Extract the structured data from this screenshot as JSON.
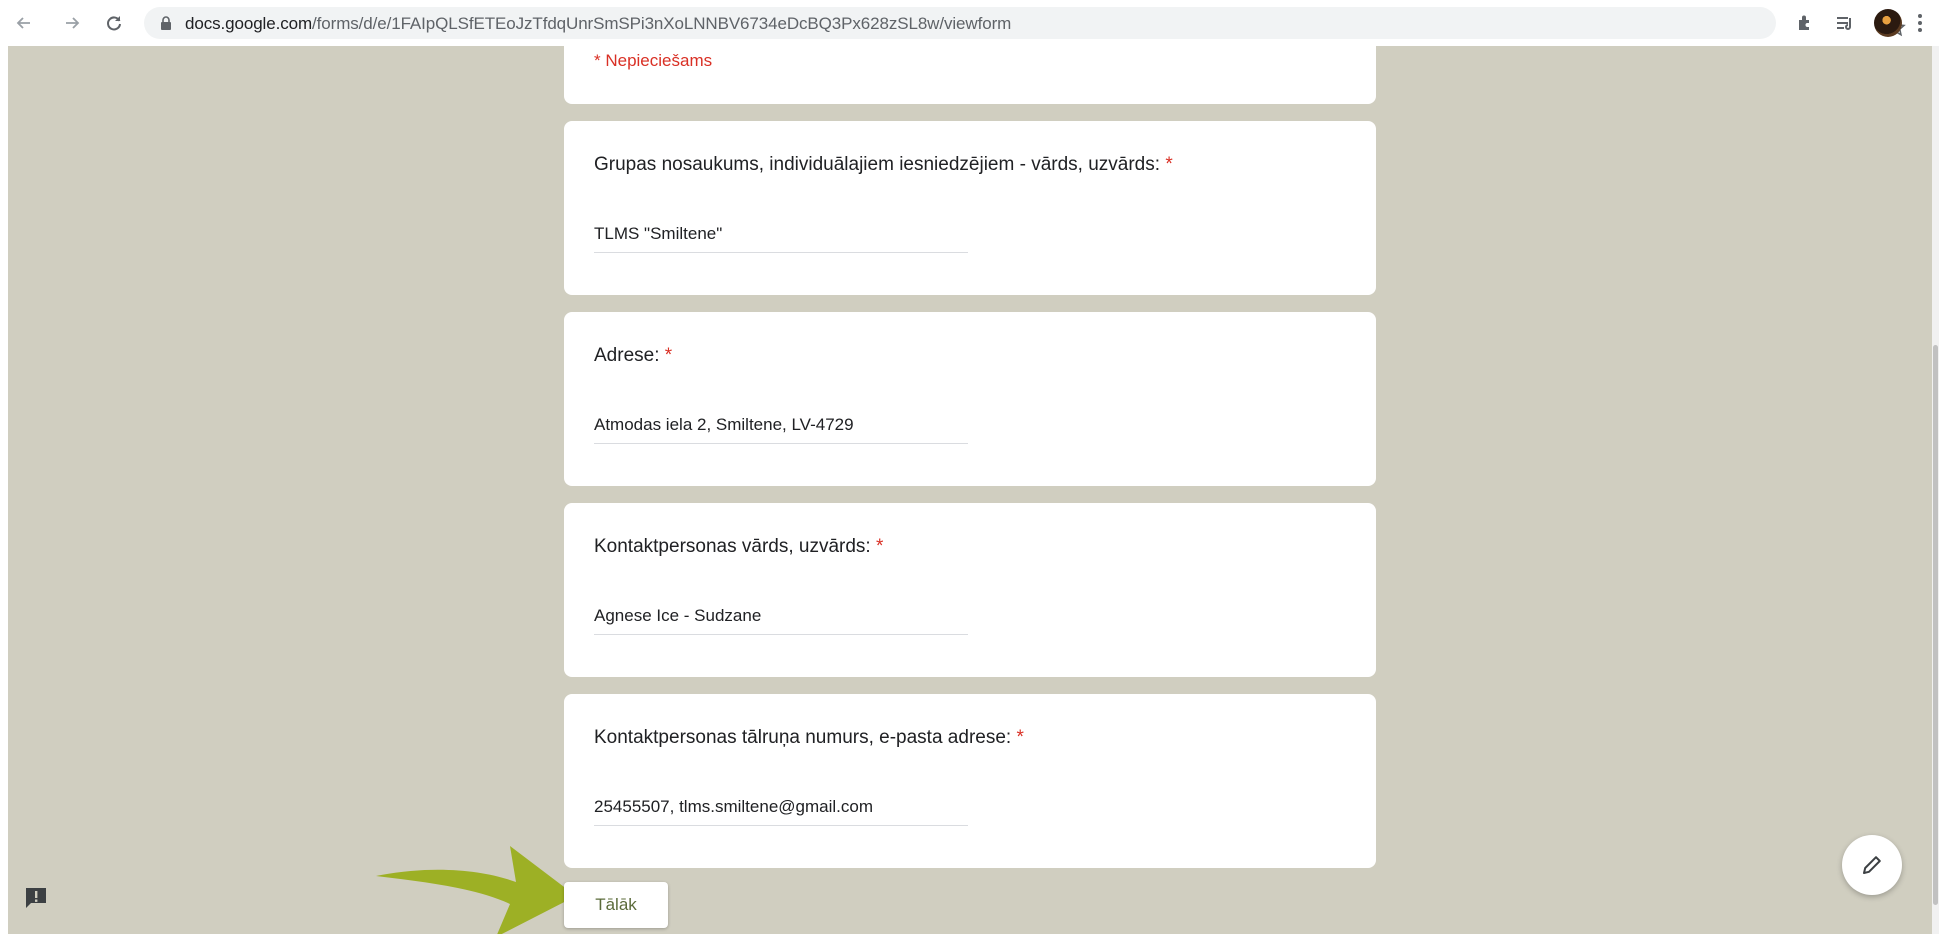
{
  "browser": {
    "url_host": "docs.google.com",
    "url_path": "/forms/d/e/1FAIpQLSfETEoJzTfdqUnrSmSPi3nXoLNNBV6734eDcBQ3Px628zSL8w/viewform"
  },
  "form": {
    "required_note": "* Nepieciešams",
    "questions": [
      {
        "label": "Grupas nosaukums, individuālajiem iesniedzējiem - vārds, uzvārds:",
        "required_mark": "*",
        "answer": "TLMS \"Smiltene\""
      },
      {
        "label": "Adrese:",
        "required_mark": "*",
        "answer": "Atmodas iela 2, Smiltene, LV-4729"
      },
      {
        "label": "Kontaktpersonas vārds, uzvārds:",
        "required_mark": "*",
        "answer": "Agnese Ice - Sudzane"
      },
      {
        "label": "Kontaktpersonas tālruņa numurs, e-pasta adrese:",
        "required_mark": "*",
        "answer": "25455507, tlms.smiltene@gmail.com"
      }
    ],
    "next_button": "Tālāk"
  },
  "colors": {
    "page_background": "#d0cec0",
    "required_red": "#d93025",
    "arrow_green": "#9db025",
    "button_text": "#5b6b3a"
  },
  "icons": [
    "back-arrow-icon",
    "forward-arrow-icon",
    "reload-icon",
    "lock-icon",
    "star-icon",
    "extensions-icon",
    "media-controls-icon",
    "profile-avatar",
    "menu-icon",
    "feedback-icon",
    "edit-pencil-icon"
  ]
}
